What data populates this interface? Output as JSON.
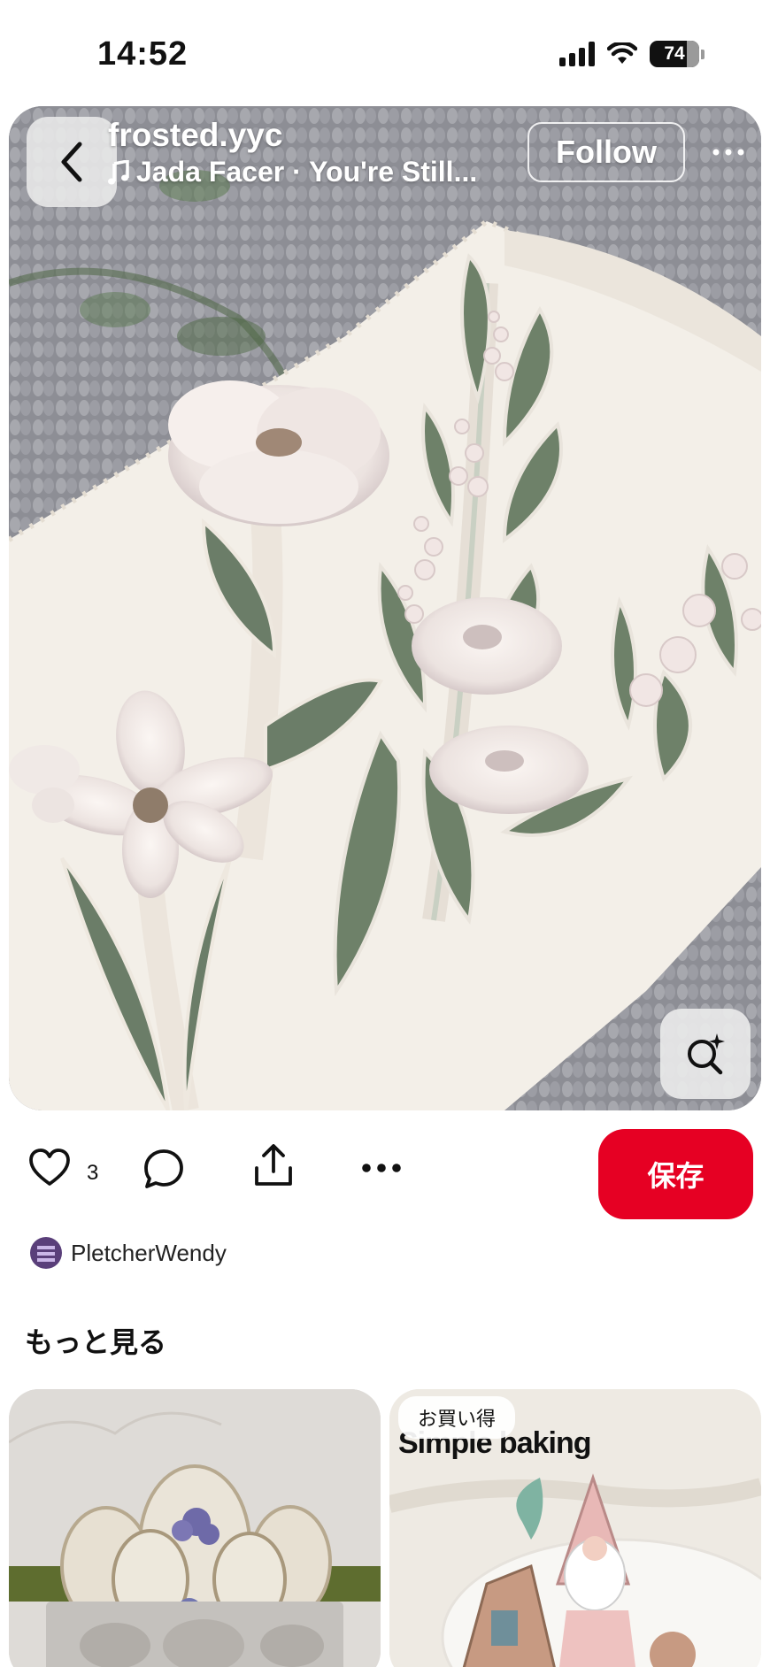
{
  "status_bar": {
    "time": "14:52",
    "battery": "74"
  },
  "pin": {
    "creator": "frosted.yyc",
    "music": "Jada Facer · You're Still...",
    "follow_label": "Follow"
  },
  "actions": {
    "like_count": "3",
    "save_label": "保存"
  },
  "pinner": {
    "name": "PletcherWendy"
  },
  "more_section": {
    "title": "もっと見る",
    "cards": [
      {
        "badge": "",
        "caption": ""
      },
      {
        "badge": "お買い得",
        "caption": "Simple baking"
      }
    ]
  },
  "colors": {
    "save": "#e60023",
    "leaf": "#6b7d68",
    "icing": "#f4f1ec"
  },
  "icons": [
    "back-arrow",
    "music-note",
    "more-horizontal",
    "visual-search",
    "heart",
    "comment",
    "share",
    "more-horizontal"
  ]
}
